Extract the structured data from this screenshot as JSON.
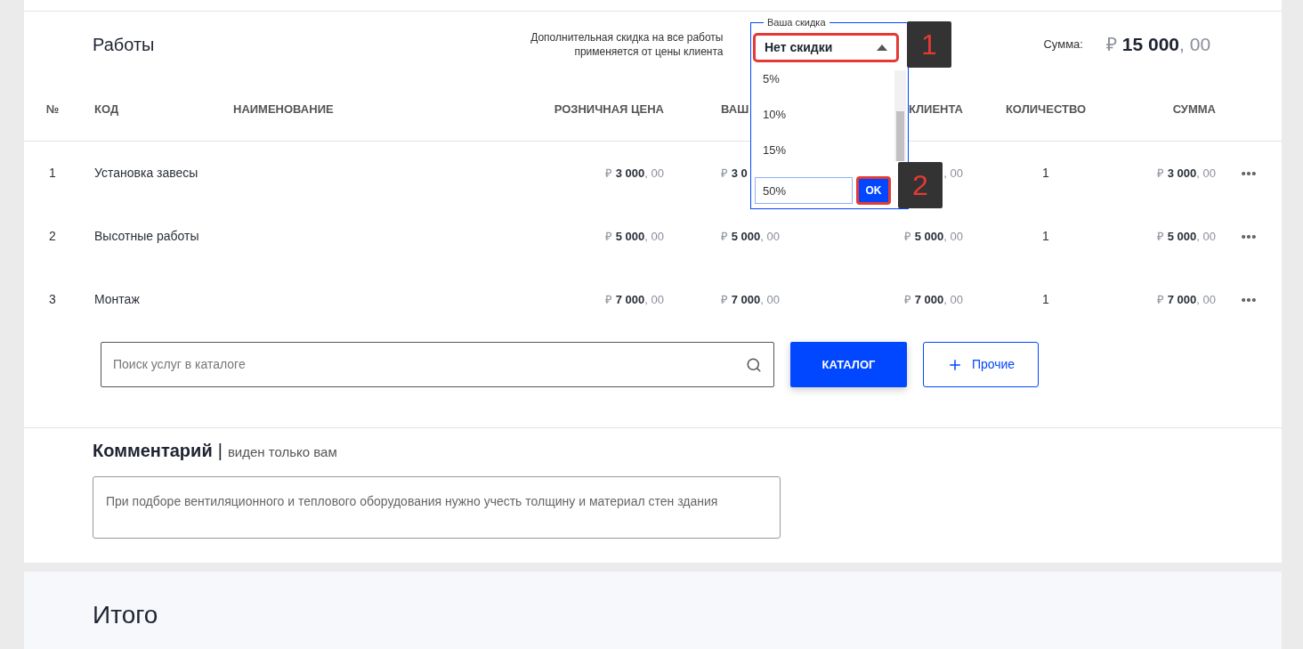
{
  "works": {
    "title": "Работы",
    "discount_note": "Дополнительная скидка на все работы применяется от цены клиента",
    "sum_label": "Сумма:",
    "sum_currency": "₽",
    "sum_value": "15 000",
    "sum_cents": ", 00"
  },
  "discount": {
    "legend": "Ваша скидка",
    "value": "Нет скидки",
    "expanded": true,
    "options": [
      {
        "label": "5%",
        "selected": false
      },
      {
        "label": "10%",
        "selected": false
      },
      {
        "label": "15%",
        "selected": false
      }
    ],
    "custom_value": "50%",
    "ok_label": "OK"
  },
  "annotations": [
    {
      "label": "1"
    },
    {
      "label": "2"
    }
  ],
  "table": {
    "columns": [
      "№",
      "КОД",
      "НАИМЕНОВАНИЕ",
      "РОЗНИЧНАЯ ЦЕНА",
      "ВАШ",
      "КЛИЕНТА",
      "КОЛИЧЕСТВО",
      "СУММА"
    ],
    "rows": [
      {
        "number": "1",
        "code": "Установка завесы",
        "retail_price": "₽ **3 000**, 00",
        "your_price": "₽ **3 0**",
        "client_price": ", 00",
        "quantity": "1",
        "sum": "₽ **3 000**, 00"
      },
      {
        "number": "2",
        "code": "Высотные работы",
        "retail_price": "₽ **5 000**, 00",
        "your_price": "₽ **5 000**, 00",
        "client_price": "₽ **5 000**, 00",
        "quantity": "1",
        "sum": "₽ **5 000**, 00"
      },
      {
        "number": "3",
        "code": "Монтаж",
        "retail_price": "₽ **7 000**, 00",
        "your_price": "₽ **7 000**, 00",
        "client_price": "₽ **7 000**, 00",
        "quantity": "1",
        "sum": "₽ **7 000**, 00"
      }
    ]
  },
  "search": {
    "placeholder": "Поиск услуг в каталоге"
  },
  "buttons": {
    "catalog": "КАТАЛОГ",
    "other": "Прочие"
  },
  "comment": {
    "title": "Комментарий",
    "separator": "|",
    "note": "виден только вам",
    "value": "При подборе вентиляционного и теплового оборудования нужно учесть толщину и материал стен здания"
  },
  "total": {
    "title": "Итого"
  }
}
